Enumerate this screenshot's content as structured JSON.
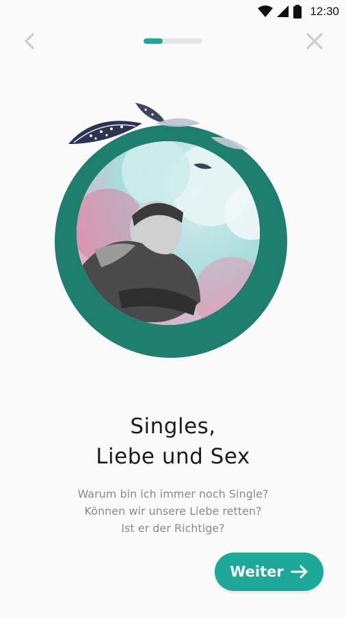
{
  "status_bar": {
    "time": "12:30",
    "icons": [
      "wifi-icon",
      "signal-icon",
      "battery-icon"
    ]
  },
  "nav": {
    "back_icon": "chevron-left-icon",
    "close_icon": "close-icon"
  },
  "progress": {
    "step_fraction": 0.33
  },
  "hero": {
    "description": "circular photo collage of a man with feathers and clouds"
  },
  "content": {
    "title_line1": "Singles,",
    "title_line2": "Liebe und Sex",
    "subtitle_lines": [
      "Warum bin ich immer noch Single?",
      "Können wir unsere Liebe retten?",
      "Ist er der Richtige?"
    ]
  },
  "actions": {
    "next_label": "Weiter",
    "next_icon": "arrow-right-icon"
  },
  "colors": {
    "accent": "#1ea89a",
    "ring": "#1e7f6e",
    "background": "#fafafa"
  }
}
